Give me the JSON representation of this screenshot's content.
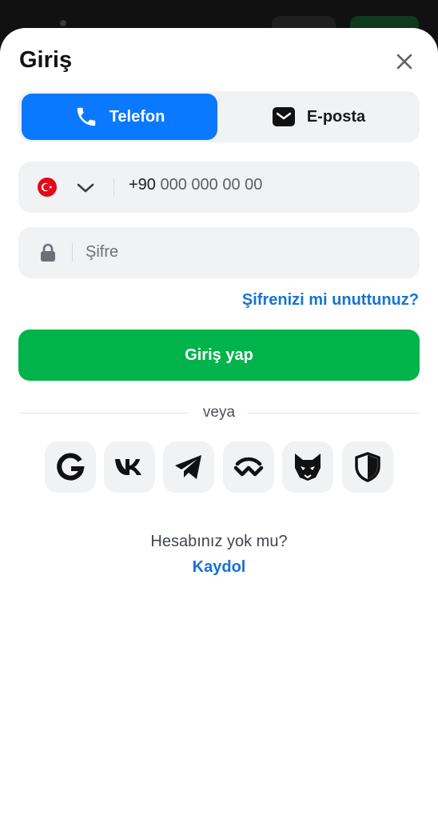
{
  "header": {
    "title": "Giriş"
  },
  "tabs": [
    {
      "label": "Telefon",
      "icon": "phone-icon",
      "active": true
    },
    {
      "label": "E-posta",
      "icon": "mail-icon",
      "active": false
    }
  ],
  "phone_field": {
    "country": "Türkiye",
    "code": "+90",
    "placeholder": "000 000 00 00"
  },
  "password_field": {
    "placeholder": "Şifre"
  },
  "forgot_link": "Şifrenizi mi unuttunuz?",
  "login_button": "Giriş yap",
  "divider": "veya",
  "social": [
    {
      "name": "google-icon"
    },
    {
      "name": "vk-icon"
    },
    {
      "name": "telegram-icon"
    },
    {
      "name": "walletconnect-icon"
    },
    {
      "name": "fox-wallet-icon"
    },
    {
      "name": "shield-icon"
    }
  ],
  "footer": {
    "question": "Hesabınız yok mu?",
    "signup": "Kaydol"
  },
  "colors": {
    "primary": "#0a78ff",
    "success": "#00b34a",
    "link": "#1773d4",
    "field_bg": "#f1f2f4"
  }
}
